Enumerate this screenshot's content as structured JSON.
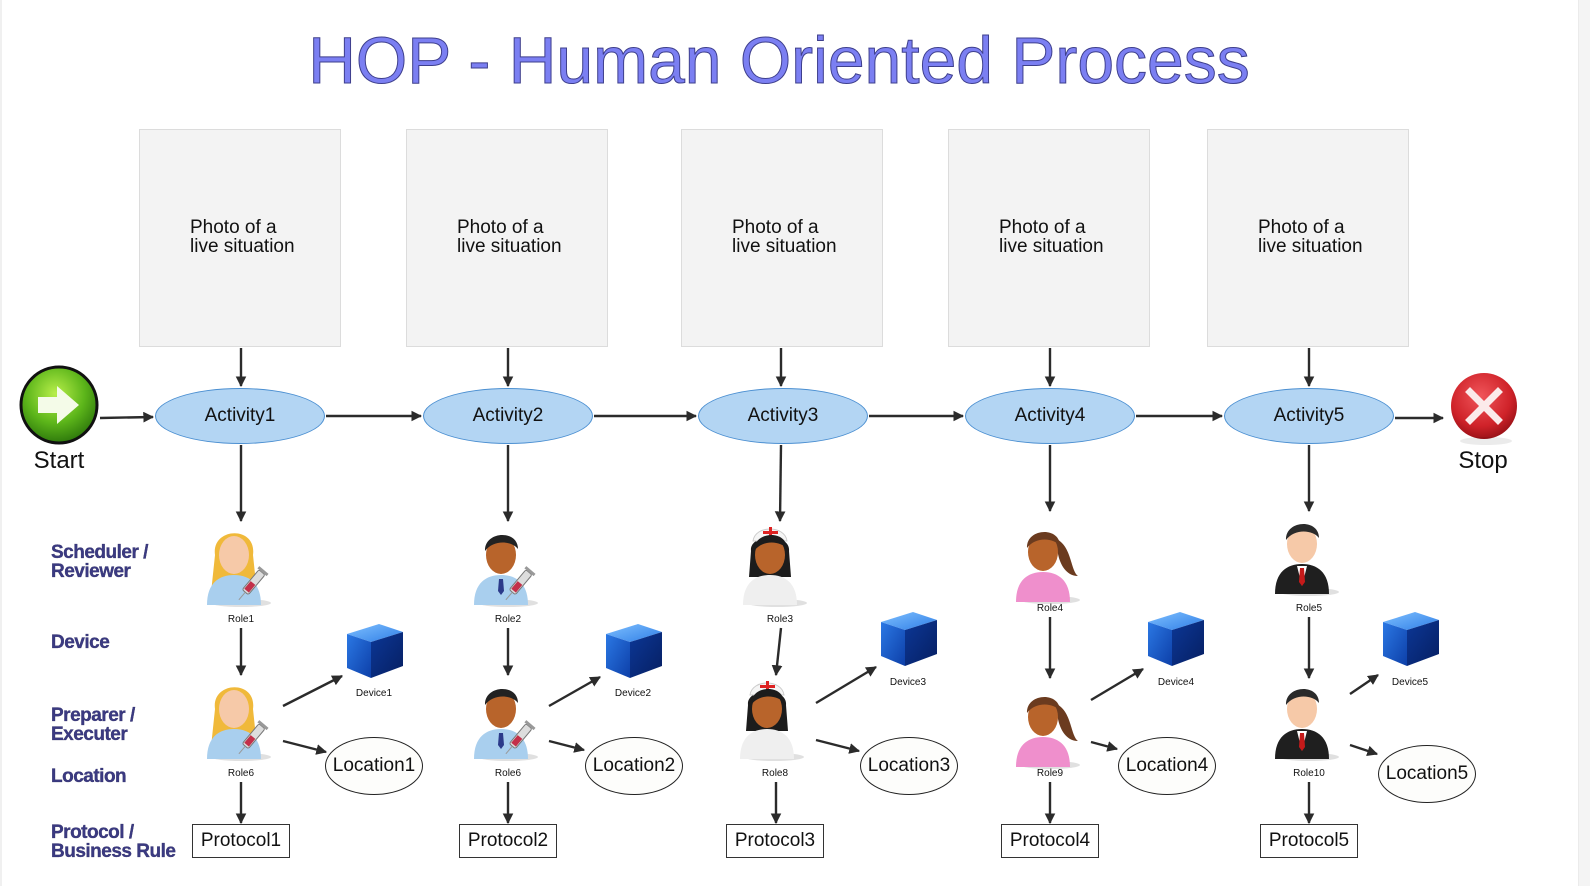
{
  "title": "HOP - Human Oriented Process",
  "start": {
    "label": "Start",
    "icon": "green-arrow-right-icon"
  },
  "stop": {
    "label": "Stop",
    "icon": "red-x-circle-icon"
  },
  "row_labels": {
    "scheduler": [
      "Scheduler /",
      "Reviewer"
    ],
    "device": "Device",
    "preparer": [
      "Preparer /",
      "Executer"
    ],
    "location": "Location",
    "protocol": [
      "Protocol /",
      "Business Rule"
    ]
  },
  "columns": [
    {
      "photo": [
        "Photo of a",
        "live situation"
      ],
      "activity": "Activity1",
      "scheduler_role": "Role1",
      "scheduler_icon": "female-doctor-syringe-icon",
      "preparer_role": "Role6",
      "preparer_icon": "female-doctor-syringe-icon",
      "device": "Device1",
      "location": "Location1",
      "protocol": "Protocol1"
    },
    {
      "photo": [
        "Photo of a",
        "live situation"
      ],
      "activity": "Activity2",
      "scheduler_role": "Role2",
      "scheduler_icon": "male-doctor-syringe-icon",
      "preparer_role": "Role6",
      "preparer_icon": "male-doctor-syringe-icon",
      "device": "Device2",
      "location": "Location2",
      "protocol": "Protocol2"
    },
    {
      "photo": [
        "Photo of a",
        "live situation"
      ],
      "activity": "Activity3",
      "scheduler_role": "Role3",
      "scheduler_icon": "nurse-icon",
      "preparer_role": "Role8",
      "preparer_icon": "nurse-icon",
      "device": "Device3",
      "location": "Location3",
      "protocol": "Protocol3"
    },
    {
      "photo": [
        "Photo of a",
        "live situation"
      ],
      "activity": "Activity4",
      "scheduler_role": "Role4",
      "scheduler_icon": "female-person-pink-icon",
      "preparer_role": "Role9",
      "preparer_icon": "female-person-pink-icon",
      "device": "Device4",
      "location": "Location4",
      "protocol": "Protocol4"
    },
    {
      "photo": [
        "Photo of a",
        "live situation"
      ],
      "activity": "Activity5",
      "scheduler_role": "Role5",
      "scheduler_icon": "businessman-icon",
      "preparer_role": "Role10",
      "preparer_icon": "businessman-icon",
      "device": "Device5",
      "location": "Location5",
      "protocol": "Protocol5"
    }
  ],
  "colors": {
    "title": "#7b7ff2",
    "activity_fill": "#b3d5f3",
    "activity_border": "#4b8fd1",
    "row_label": "#3b3a82",
    "photo_fill": "#f3f3f3",
    "device_cube": "#1f5fcf",
    "start": "#66c11c",
    "stop": "#d6282f"
  }
}
